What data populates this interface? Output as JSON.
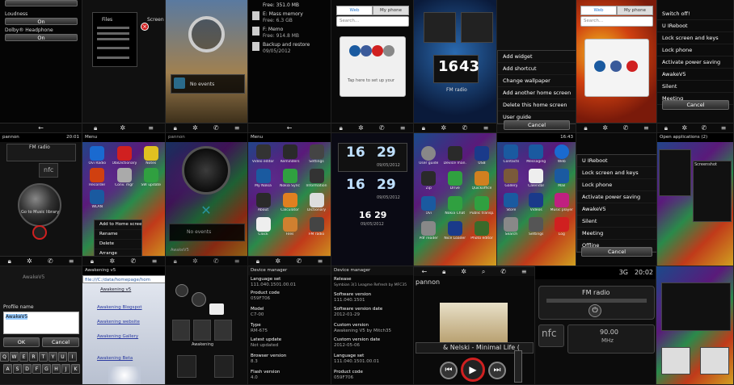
{
  "tiles": {
    "t1": {
      "loudness_label": "Loudness",
      "loudness_value": "On",
      "dolby_label": "Dolby® Headphone",
      "dolby_value": "On"
    },
    "t2": {
      "files_label": "Files",
      "screen_label": "Screen"
    },
    "t3": {},
    "t4": {
      "mem1": "Free: 351.0 MB",
      "mem2_title": "E: Mass memory",
      "mem2_free": "Free: 6.3 GB",
      "mem3_title": "F: Memo",
      "mem3_free": "Free: 914.8 MB",
      "backup_title": "Backup and restore",
      "backup_date": "09/05/2012"
    },
    "t5": {
      "tab_web": "Web",
      "tab_phone": "My phone",
      "search_placeholder": "Search...",
      "tap_hint": "Tap here to set up your"
    },
    "t6": {
      "clock_h": "16",
      "clock_m": "43",
      "fm_label": "FM radio"
    },
    "t7": {
      "menu": [
        "Add widget",
        "Add shortcut",
        "Change wallpaper",
        "Add another home screen",
        "Delete this home screen",
        "User guide"
      ],
      "cancel": "Cancel"
    },
    "t8": {
      "tab_web": "Web",
      "tab_phone": "My phone",
      "search_placeholder": "Search..."
    },
    "t9": {
      "menu": [
        "Switch off!",
        "U IReboot",
        "Lock screen and keys",
        "Lock phone",
        "Activate power saving",
        "AwakeV5",
        "Silent",
        "Meeting"
      ],
      "cancel": "Cancel"
    },
    "r2a": {
      "operator": "pannon",
      "time": "20:01",
      "fm_label": "FM radio",
      "nfc": "nfc",
      "fm_freq": "90.00 MHz",
      "music_label": "Go to Music library"
    },
    "r2b": {
      "title": "Menu",
      "apps": [
        "Ovi Radio",
        "ObiDictionary",
        "Notes",
        "Recorder",
        "Conv. mgr",
        "SW update",
        "WLAN",
        "Add to Home screen",
        "Rename"
      ],
      "ctx": [
        "Add to Home screen",
        "Rename",
        "Delete",
        "Arrange"
      ]
    },
    "r2c": {
      "operator": "pannon",
      "events": "No events",
      "footer": "AwakeV5"
    },
    "r2d": {
      "title": "Menu",
      "apps": [
        "Video editor",
        "Reminders",
        "Settings",
        "My Nokia",
        "Nokia Sync",
        "Information",
        "About",
        "Calculator",
        "Dictionary",
        "Clock",
        "Files",
        "FM radio"
      ]
    },
    "r2e": {
      "h1": "16",
      "m1": "29",
      "d1": "09/05/2012",
      "h2": "16",
      "m2": "29",
      "d2": "09/05/2012",
      "small_time": "16 29",
      "small_date": "09/05/2012"
    },
    "r2f": {
      "apps": [
        "User guide",
        "Device man.",
        "USB",
        "Zip",
        "Drive",
        "Quickoffice",
        "Ovi",
        "Nokia Chat",
        "Public transp.",
        "Pdf reader",
        "Nice Loader",
        "Photo editor"
      ]
    },
    "r2g": {
      "time": "16:43",
      "apps": [
        "Contacts",
        "Messaging",
        "Web",
        "Gallery",
        "Calendar",
        "Mail",
        "Store",
        "Videos",
        "Music player",
        "Search",
        "Settings",
        "Log"
      ]
    },
    "r2h": {
      "menu": [
        "U IReboot",
        "Lock screen and keys",
        "Lock phone",
        "Activate power saving",
        "AwakeV5",
        "Silent",
        "Meeting",
        "Offline"
      ],
      "cancel": "Cancel"
    },
    "r2i": {
      "title": "Open applications (2)",
      "screenshot": "Screenshot"
    },
    "r3a": {
      "title": "AwakeV5",
      "field_label": "Profile name",
      "field_value": "AwakeV5",
      "ok": "OK",
      "cancel": "Cancel",
      "keys1": [
        "Q",
        "W",
        "E",
        "R",
        "T",
        "Y",
        "U",
        "I",
        "O",
        "P"
      ],
      "keys2": [
        "A",
        "S",
        "D",
        "F",
        "G",
        "H",
        "J",
        "K",
        "L"
      ]
    },
    "r3b": {
      "title": "Awakening v5",
      "url": "file:///C:/data/homepage/hom",
      "links": [
        "Awakening v5",
        "Awakening Blogspot",
        "Awakening website",
        "Awakening Gallery",
        "Awakening Beta"
      ]
    },
    "r3c": {
      "contact": "Awakening"
    },
    "r3d": {
      "title": "Device manager",
      "rows": [
        {
          "k": "Language set",
          "v": "111.040.1501.00.01"
        },
        {
          "k": "Product code",
          "v": "059F706"
        },
        {
          "k": "Model",
          "v": "C7-00"
        },
        {
          "k": "Type",
          "v": "RM-675"
        },
        {
          "k": "Latest update",
          "v": "Not updated"
        },
        {
          "k": "Browser version",
          "v": "8.3"
        },
        {
          "k": "Flash version",
          "v": "4.0"
        }
      ]
    },
    "r3e": {
      "title": "Device manager",
      "rows": [
        {
          "k": "Release",
          "v": "Symbian 3(1 Leagme Refresh by MFC35"
        },
        {
          "k": "Software version",
          "v": "111.040.1501"
        },
        {
          "k": "Software version date",
          "v": "2012-01-29"
        },
        {
          "k": "Custom version",
          "v": "Awakening V5 by Mitch35"
        },
        {
          "k": "Custom version date",
          "v": "2012-05-06"
        },
        {
          "k": "Language set",
          "v": "111.040.1501.00.01"
        },
        {
          "k": "Product code",
          "v": "059F706"
        }
      ]
    },
    "r3f": {
      "operator": "pannon",
      "now_playing": "& Nelski - Minimal Life ("
    },
    "r3g": {
      "time": "20:02",
      "fm_label": "FM radio",
      "nfc": "nfc",
      "freq": "90.00",
      "unit": "MHz",
      "net": "3G"
    },
    "r3h": {}
  },
  "colors": {
    "accent_blue": "#2a7ad0",
    "bg": "#000000",
    "red": "#d02020"
  },
  "icons": [
    "back-arrow-icon",
    "lock-icon",
    "gear-icon",
    "search-icon",
    "phone-icon",
    "menu-icon",
    "play-icon",
    "prev-icon",
    "next-icon",
    "power-icon"
  ]
}
